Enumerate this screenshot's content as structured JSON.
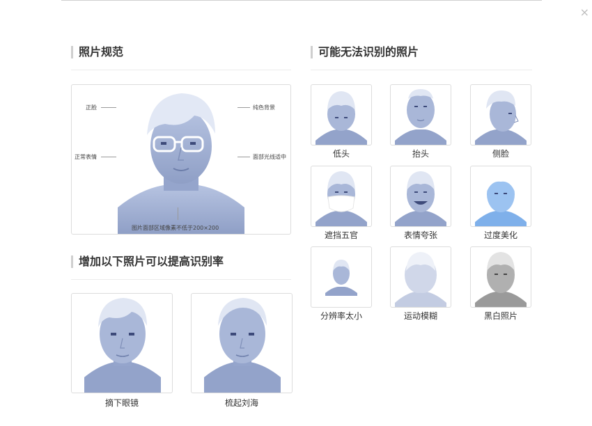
{
  "dialog": {
    "close_glyph": "×"
  },
  "spec": {
    "title": "照片规范",
    "annotations": {
      "front_face": "正脸",
      "solid_bg": "纯色背景",
      "normal_expr": "正常表情",
      "light_even": "面部光线适中",
      "pixel_req": "图片面部区域像素不低于200×200"
    }
  },
  "improve": {
    "title": "增加以下照片可以提高识别率",
    "items": [
      {
        "label": "摘下眼镜"
      },
      {
        "label": "梳起刘海"
      }
    ]
  },
  "unrecognizable": {
    "title": "可能无法识别的照片",
    "items": [
      {
        "label": "低头"
      },
      {
        "label": "抬头"
      },
      {
        "label": "侧脸"
      },
      {
        "label": "遮挡五官"
      },
      {
        "label": "表情夸张"
      },
      {
        "label": "过度美化"
      },
      {
        "label": "分辨率太小"
      },
      {
        "label": "运动模糊"
      },
      {
        "label": "黑白照片"
      }
    ]
  },
  "colors": {
    "skin": "#a9b7d8",
    "skin_dark": "#7f8fb8",
    "hair": "#dfe5f3",
    "mono": "#a8a8a8",
    "blue_bright": "#7fb0ea"
  }
}
